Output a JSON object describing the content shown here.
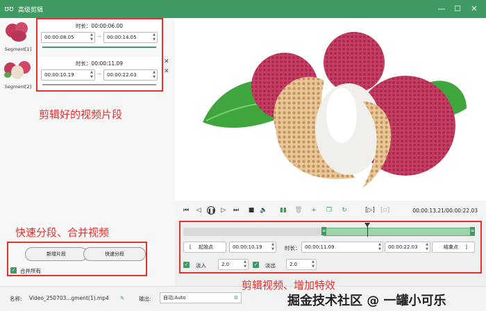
{
  "window": {
    "title": "高级剪辑",
    "controls": [
      "—",
      "☐",
      "✕"
    ]
  },
  "segments": [
    {
      "label": "Segment[1]",
      "duration": "时长：00:00:06.00",
      "start": "00:00:08.05",
      "end": "00:00:14.05"
    },
    {
      "label": "Segment[2]",
      "duration": "时长：00:00:11.09",
      "start": "00:00:10.19",
      "end": "00:00:22.03"
    }
  ],
  "segment_separator": "~",
  "annotations": {
    "segments": "剪辑好的视频片段",
    "split_merge": "快速分段、合并视频",
    "effects": "剪辑视频、增加特效"
  },
  "buttons": {
    "add_segment": "新增片段",
    "quick_split": "快速分段"
  },
  "merge_all": {
    "label": "合并所有",
    "checked": true
  },
  "player": {
    "timecode": "00:00:13.21/00:00:22.03",
    "playhead_fraction": 0.615
  },
  "range": {
    "start_label": "起始点",
    "start_value": "00:00:10.19",
    "duration_label": "时长：",
    "duration_value": "00:00:11.09",
    "end_value": "00:00:22.03",
    "end_label": "结束点",
    "bracket_left": "[",
    "bracket_right": "]"
  },
  "fade": {
    "in_label": "淡入",
    "in_value": "2.0",
    "in_checked": true,
    "out_label": "淡出",
    "out_value": "2.0",
    "out_checked": true
  },
  "footer": {
    "name_label": "名称:",
    "name_value": "Video_250703...gment(1).mp4",
    "output_label": "输出:",
    "output_value": "自动;Auto",
    "watermark": "掘金技术社区 @ 一罐小可乐"
  },
  "colors": {
    "brand": "#3f9a63",
    "annotation": "#e5312d",
    "timeline_selection": "#9fd3ab"
  }
}
